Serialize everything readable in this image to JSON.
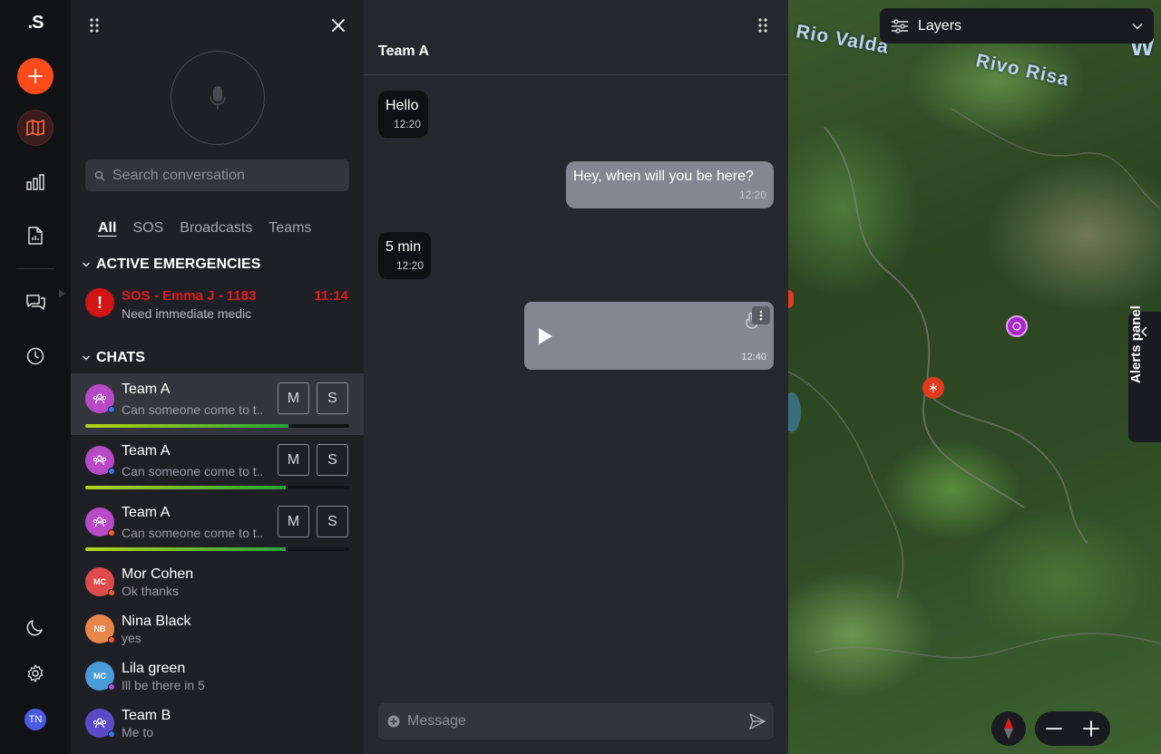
{
  "rail": {
    "logo": ".S",
    "avatar_initials": "TN",
    "colors": {
      "accent": "#ff4a1c",
      "active_ring": "#3a1d1b"
    }
  },
  "conversations": {
    "search_placeholder": "Search conversation",
    "tabs": [
      "All",
      "SOS",
      "Broadcasts",
      "Teams"
    ],
    "active_tab": "All",
    "emergencies_heading": "ACTIVE EMERGENCIES",
    "emergency": {
      "title": "SOS - Emma J - 1183",
      "time": "11:14",
      "message": "Need immediate medic",
      "icon": "!"
    },
    "chats_heading": "CHATS",
    "team_chats": [
      {
        "name": "Team A",
        "preview": "Can someone come to t..",
        "btn_m": "M",
        "btn_s": "S",
        "progress": 0.77,
        "status_color": "#2e7bf0"
      },
      {
        "name": "Team A",
        "preview": "Can someone come to t..",
        "btn_m": "M",
        "btn_s": "S",
        "progress": 0.76,
        "status_color": "#2e7bf0"
      },
      {
        "name": "Team A",
        "preview": "Can someone come to t..",
        "btn_m": "M",
        "btn_s": "S",
        "progress": 0.76,
        "status_color": "#ff5a1f"
      }
    ],
    "contacts": [
      {
        "name": "Mor Cohen",
        "preview": "Ok thanks",
        "initials": "MC",
        "color": "#e04a4a",
        "status_color": "#ff5a1f"
      },
      {
        "name": "Nina Black",
        "preview": "yes",
        "initials": "NB",
        "color": "#e8864a",
        "status_color": "#ff5a1f"
      },
      {
        "name": "Lila green",
        "preview": "Ill be there in 5",
        "initials": "MC",
        "color": "#4a9bd8",
        "status_color": "#b84ae0"
      },
      {
        "name": "Team B",
        "preview": "Me to",
        "initials": "",
        "color": "#5b4ac8",
        "status_color": "#2e7bf0"
      }
    ]
  },
  "chat": {
    "title": "Team A",
    "messages": [
      {
        "dir": "in",
        "text": "Hello",
        "time": "12:20"
      },
      {
        "dir": "out",
        "text": "Hey, when will you be here?",
        "time": "12:20"
      },
      {
        "dir": "in",
        "text": "5 min",
        "time": "12:20"
      }
    ],
    "voice_time": "12:40",
    "message_placeholder": "Message"
  },
  "map": {
    "labels": [
      "Rio Valda",
      "Rivo Risa"
    ],
    "partial_label": "W",
    "layers_label": "Layers",
    "alerts_label": "Alerts panel"
  }
}
